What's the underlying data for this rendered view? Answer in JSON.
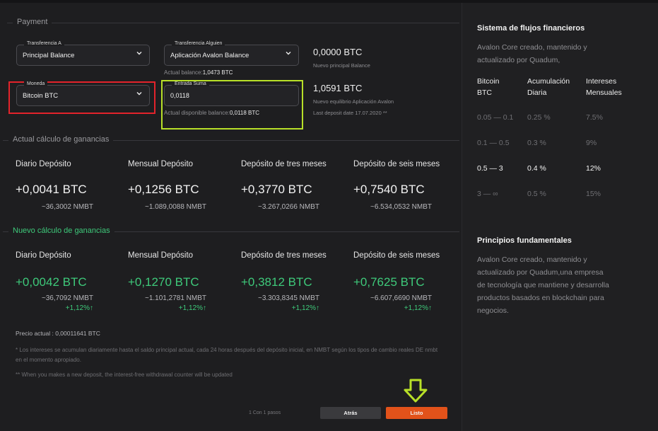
{
  "payment": {
    "legend": "Payment",
    "transfer_from": {
      "label": "Transferencia A",
      "value": "Principal Balance"
    },
    "transfer_to": {
      "label": "Transferencia Alguien",
      "value": "Aplicación Avalon Balance"
    },
    "currency": {
      "label": "Moneda",
      "value": "Bitcoin BTC"
    },
    "amount": {
      "label": "Entrada Suma",
      "value": "0,0118"
    },
    "actual_balance_label": "Actual balance:",
    "actual_balance_value": "1,0473 BTC",
    "available_balance_label": "Actual disponible balance:",
    "available_balance_value": "0,0118 BTC",
    "principal_amount": "0,0000 BTC",
    "principal_label": "Nuevo principal Balance",
    "app_amount": "1,0591 BTC",
    "app_label": "Nuevo equilibrio Aplicación Avalon",
    "last_deposit": "Last deposit date 17.07.2020 **"
  },
  "current_calc": {
    "legend": "Actual cálculo de ganancias",
    "columns": [
      {
        "title": "Diario Depósito",
        "btc": "+0,0041 BTC",
        "nmbt": "~36,3002 NMBT"
      },
      {
        "title": "Mensual Depósito",
        "btc": "+0,1256 BTC",
        "nmbt": "~1.089,0088 NMBT"
      },
      {
        "title": "Depósito de tres meses",
        "btc": "+0,3770 BTC",
        "nmbt": "~3.267,0266 NMBT"
      },
      {
        "title": "Depósito de seis meses",
        "btc": "+0,7540 BTC",
        "nmbt": "~6.534,0532 NMBT"
      }
    ]
  },
  "new_calc": {
    "legend": "Nuevo cálculo de ganancias",
    "columns": [
      {
        "title": "Diario Depósito",
        "btc": "+0,0042 BTC",
        "nmbt": "~36,7092 NMBT",
        "pct": "+1,12%↑"
      },
      {
        "title": "Mensual Depósito",
        "btc": "+0,1270 BTC",
        "nmbt": "~1.101,2781 NMBT",
        "pct": "+1,12%↑"
      },
      {
        "title": "Depósito de tres meses",
        "btc": "+0,3812 BTC",
        "nmbt": "~3.303,8345 NMBT",
        "pct": "+1,12%↑"
      },
      {
        "title": "Depósito de seis meses",
        "btc": "+0,7625 BTC",
        "nmbt": "~6.607,6690 NMBT",
        "pct": "+1,12%↑"
      }
    ]
  },
  "notes": {
    "price": "Precio actual : 0,00011641 BTC",
    "note1": "* Los intereses se acumulan diariamente hasta el saldo principal actual, cada 24 horas después del depósito inicial, en NMBT según los tipos de cambio reales DE nmbt en el momento apropiado.",
    "note2": "** When you makes a new deposit, the interest-free withdrawal counter will be updated"
  },
  "footer": {
    "steps": "1 Con 1 pasos",
    "back": "Atrás",
    "done": "Listo"
  },
  "sidebar": {
    "title1": "Sistema de flujos financieros",
    "text1": "Avalon Core creado, mantenido y actualizado por Quadum,",
    "headers": [
      "Bitcoin BTC",
      "Acumulación Diaria",
      "Intereses Mensuales"
    ],
    "rows": [
      [
        "0.05 — 0.1",
        "0.25 %",
        "7.5%"
      ],
      [
        "0.1 — 0.5",
        "0.3 %",
        "9%"
      ],
      [
        "0.5 — 3",
        "0.4 %",
        "12%"
      ],
      [
        "3 — ∞",
        "0.5 %",
        "15%"
      ]
    ],
    "title2": "Principios fundamentales",
    "text2": "Avalon Core creado, mantenido y actualizado por Quadum,una empresa de tecnología que mantiene y desarrolla productos basados en blockchain para negocios."
  },
  "colors": {
    "accent": "#e2521a",
    "positive": "#3ec97a",
    "highlight_red": "#e3232b",
    "highlight_lime": "#b8e028"
  }
}
